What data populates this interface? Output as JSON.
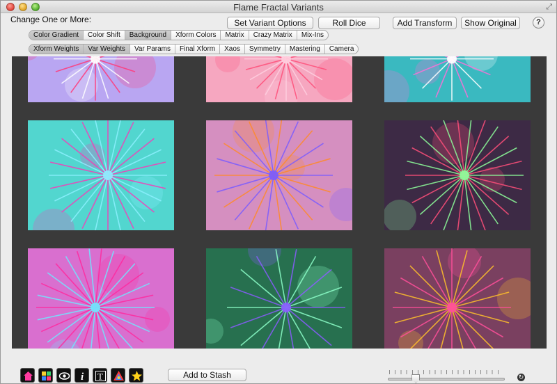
{
  "window": {
    "title": "Flame Fractal Variants"
  },
  "header": {
    "change_label": "Change One or More:",
    "buttons": {
      "set_variant_options": "Set Variant Options",
      "roll_dice": "Roll Dice",
      "add_transform": "Add Transform",
      "show_original": "Show Original",
      "help": "?"
    }
  },
  "tabs_row1": [
    {
      "label": "Color Gradient",
      "selected": true
    },
    {
      "label": "Color Shift",
      "selected": false
    },
    {
      "label": "Background",
      "selected": true
    },
    {
      "label": "Xform Colors",
      "selected": false
    },
    {
      "label": "Matrix",
      "selected": false
    },
    {
      "label": "Crazy Matrix",
      "selected": false
    },
    {
      "label": "Mix-Ins",
      "selected": false
    }
  ],
  "tabs_row2": [
    {
      "label": "Xform Weights",
      "selected": true
    },
    {
      "label": "Var Weights",
      "selected": true
    },
    {
      "label": "Var Params",
      "selected": false
    },
    {
      "label": "Final Xform",
      "selected": false
    },
    {
      "label": "Xaos",
      "selected": false
    },
    {
      "label": "Symmetry",
      "selected": false
    },
    {
      "label": "Mastering",
      "selected": false
    },
    {
      "label": "Camera",
      "selected": false
    }
  ],
  "thumbnails": [
    {
      "bg": "#b9a6f2",
      "c1": "#ff3a7a",
      "c2": "#ffffff",
      "spokes": 20
    },
    {
      "bg": "#f6a7c0",
      "c1": "#ff4f7a",
      "c2": "#ffd0e0",
      "spokes": 24
    },
    {
      "bg": "#3ab9c0",
      "c1": "#ff6fd8",
      "c2": "#ffffff",
      "spokes": 16
    },
    {
      "bg": "#52d6cf",
      "c1": "#f23fb8",
      "c2": "#8cf0ff",
      "spokes": 28
    },
    {
      "bg": "#d58fc0",
      "c1": "#ff8a2a",
      "c2": "#7a5cff",
      "spokes": 22
    },
    {
      "bg": "#3d2a45",
      "c1": "#ff4f7a",
      "c2": "#8dff9a",
      "spokes": 26
    },
    {
      "bg": "#d96fcf",
      "c1": "#ff2aa0",
      "c2": "#6fe8ff",
      "spokes": 30
    },
    {
      "bg": "#27704f",
      "c1": "#8dffc9",
      "c2": "#8a5cff",
      "spokes": 18
    },
    {
      "bg": "#7a4060",
      "c1": "#ffc02a",
      "c2": "#ff4f9a",
      "spokes": 24
    }
  ],
  "footer": {
    "tools": [
      {
        "name": "home-icon",
        "color": "#ff3aa0"
      },
      {
        "name": "palette-grid-icon",
        "color": "#f8d030"
      },
      {
        "name": "eye-icon",
        "color": "#ffffff"
      },
      {
        "name": "info-icon",
        "color": "#ffffff"
      },
      {
        "name": "text-icon",
        "color": "#ffffff"
      },
      {
        "name": "color-wheel-icon",
        "color": "#3a8aff"
      },
      {
        "name": "star-icon",
        "color": "#ffd21a"
      }
    ],
    "add_to_stash": "Add to Stash",
    "slider_value": 0.24
  }
}
